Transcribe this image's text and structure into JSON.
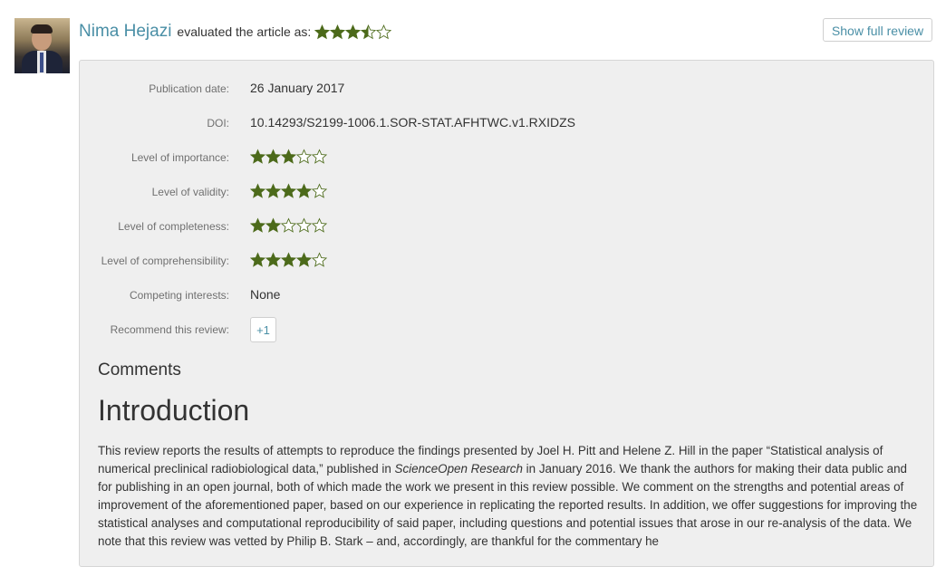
{
  "reviewer": {
    "name": "Nima Hejazi",
    "eval_text": "evaluated the article as:",
    "overall_rating": 3.5
  },
  "show_full_label": "Show full review",
  "details": {
    "publication_date_label": "Publication date:",
    "publication_date": "26 January 2017",
    "doi_label": "DOI:",
    "doi": "10.14293/S2199-1006.1.SOR-STAT.AFHTWC.v1.RXIDZS",
    "importance_label": "Level of importance:",
    "importance": 3,
    "validity_label": "Level of validity:",
    "validity": 4,
    "completeness_label": "Level of completeness:",
    "completeness": 2,
    "comprehensibility_label": "Level of comprehensibility:",
    "comprehensibility": 4,
    "competing_label": "Competing interests:",
    "competing": "None",
    "recommend_label": "Recommend this review:",
    "recommend_button": "+1"
  },
  "comments_heading": "Comments",
  "intro_heading": "Introduction",
  "intro": {
    "part1": "This review reports the results of attempts to reproduce the findings presented by Joel H. Pitt and Helene Z. Hill in the paper “Statistical analysis of numerical preclinical radiobiological data,” published in ",
    "journal": "ScienceOpen Research",
    "part2": " in January 2016. We thank the authors for making their data public and for publishing in an open journal, both of which made the work we present in this review possible. We comment on the strengths and potential areas of improvement of the aforementioned paper, based on our experience in replicating the reported results. In addition, we offer suggestions for improving the statistical analyses and computational reproducibility of said paper, including questions and potential issues that arose in our re-analysis of the data. We note that this review was vetted by Philip B. Stark – and, accordingly, are thankful for the commentary he"
  },
  "colors": {
    "accent": "#4a8fa6",
    "star_fill": "#4c6a1a",
    "panel_bg": "#efefef"
  }
}
